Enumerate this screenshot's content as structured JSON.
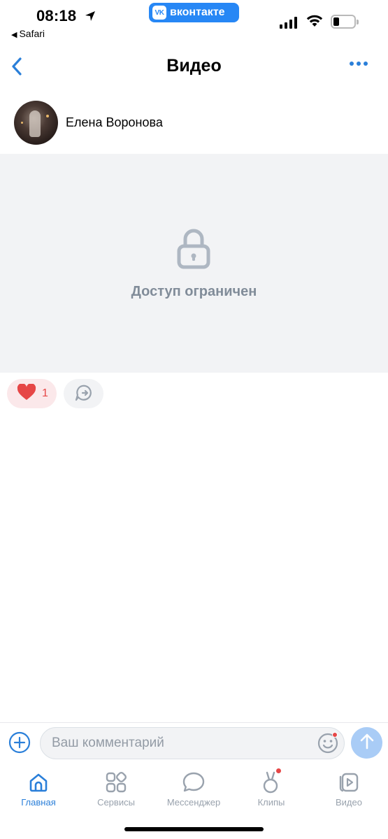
{
  "status_bar": {
    "time": "08:18",
    "back_app": "Safari",
    "vk_label": "вконтакте",
    "vk_logo": "VK"
  },
  "header": {
    "title": "Видео"
  },
  "author": {
    "name": "Елена Воронова"
  },
  "video": {
    "restricted_text": "Доступ ограничен"
  },
  "reactions": {
    "likes_count": "1"
  },
  "comment": {
    "placeholder": "Ваш комментарий"
  },
  "tabs": [
    {
      "label": "Главная",
      "icon": "home-icon",
      "active": true
    },
    {
      "label": "Сервисы",
      "icon": "services-icon",
      "active": false
    },
    {
      "label": "Мессенджер",
      "icon": "messenger-icon",
      "active": false
    },
    {
      "label": "Клипы",
      "icon": "clips-icon",
      "active": false
    },
    {
      "label": "Видео",
      "icon": "video-icon",
      "active": false
    }
  ],
  "colors": {
    "accent": "#2a7fd9",
    "vk_brand": "#2787f5",
    "like_red": "#e64646",
    "muted": "#818c99"
  }
}
